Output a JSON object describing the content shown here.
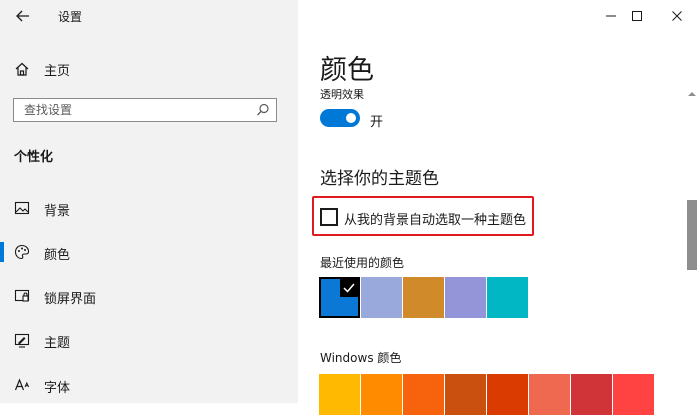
{
  "window": {
    "title": "设置"
  },
  "sidebar": {
    "home_label": "主页",
    "search_placeholder": "查找设置",
    "section_title": "个性化",
    "items": [
      {
        "label": "背景",
        "icon": "picture-icon",
        "active": false
      },
      {
        "label": "颜色",
        "icon": "palette-icon",
        "active": true
      },
      {
        "label": "锁屏界面",
        "icon": "lock-screen-icon",
        "active": false
      },
      {
        "label": "主题",
        "icon": "theme-brush-icon",
        "active": false
      },
      {
        "label": "字体",
        "icon": "font-icon",
        "active": false
      }
    ]
  },
  "content": {
    "page_title": "颜色",
    "transparency_label": "透明效果",
    "transparency_toggle": {
      "on": true,
      "state_label": "开"
    },
    "accent_heading": "选择你的主题色",
    "auto_pick_checkbox": {
      "label": "从我的背景自动选取一种主题色",
      "checked": false
    },
    "recent_colors_label": "最近使用的颜色",
    "recent_colors": [
      "#0a78d4",
      "#99a9dc",
      "#d18a2a",
      "#9494d8",
      "#00b7c3"
    ],
    "recent_selected_index": 0,
    "windows_colors_label": "Windows 颜色",
    "windows_colors": [
      "#ffb900",
      "#ff8c00",
      "#f7630c",
      "#ca5010",
      "#da3b01",
      "#ef6950",
      "#d13438",
      "#ff4343"
    ]
  },
  "colors": {
    "accent": "#0078d7",
    "highlight": "#e0191f",
    "sidebar_bg": "#f2f2f2"
  }
}
